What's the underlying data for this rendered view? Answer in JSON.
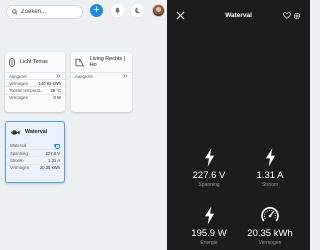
{
  "topbar": {
    "search_placeholder": "Zoeken...",
    "add_symbol": "+"
  },
  "cards": {
    "licht_terras": {
      "title": "Licht Terras",
      "rows": [
        {
          "label": "Aangezet",
          "value": ""
        },
        {
          "label": "Vermogen",
          "value": "140.93 kWh"
        },
        {
          "label": "Toestel temperat...",
          "value": "29 °C"
        },
        {
          "label": "Vermogen",
          "value": "0 W"
        }
      ]
    },
    "living_rechts": {
      "title": "Living Rechts | Ho",
      "rows": [
        {
          "label": "Aangezet",
          "value": ""
        }
      ]
    },
    "waterval": {
      "title": "Waterval",
      "rows": [
        {
          "label": "Waterval",
          "value": ""
        },
        {
          "label": "Spanning",
          "value": "227.6 V"
        },
        {
          "label": "Stroom",
          "value": "1.31 A"
        },
        {
          "label": "Vermogen",
          "value": "20.35 kWh"
        }
      ]
    }
  },
  "panel": {
    "title": "Waterval",
    "stats": [
      {
        "value": "227.6 V",
        "label": "Spanning",
        "icon": "lightning-icon"
      },
      {
        "value": "1.31 A",
        "label": "Stroom",
        "icon": "lightning-icon"
      },
      {
        "value": "195.9 W",
        "label": "Energie",
        "icon": "lightning-icon"
      },
      {
        "value": "20.35 kWh",
        "label": "Vermogen",
        "icon": "gauge-icon"
      }
    ]
  },
  "colors": {
    "accent": "#1e88e5",
    "panel_bg": "#1c1c1c",
    "page_bg": "#eef0f2"
  }
}
